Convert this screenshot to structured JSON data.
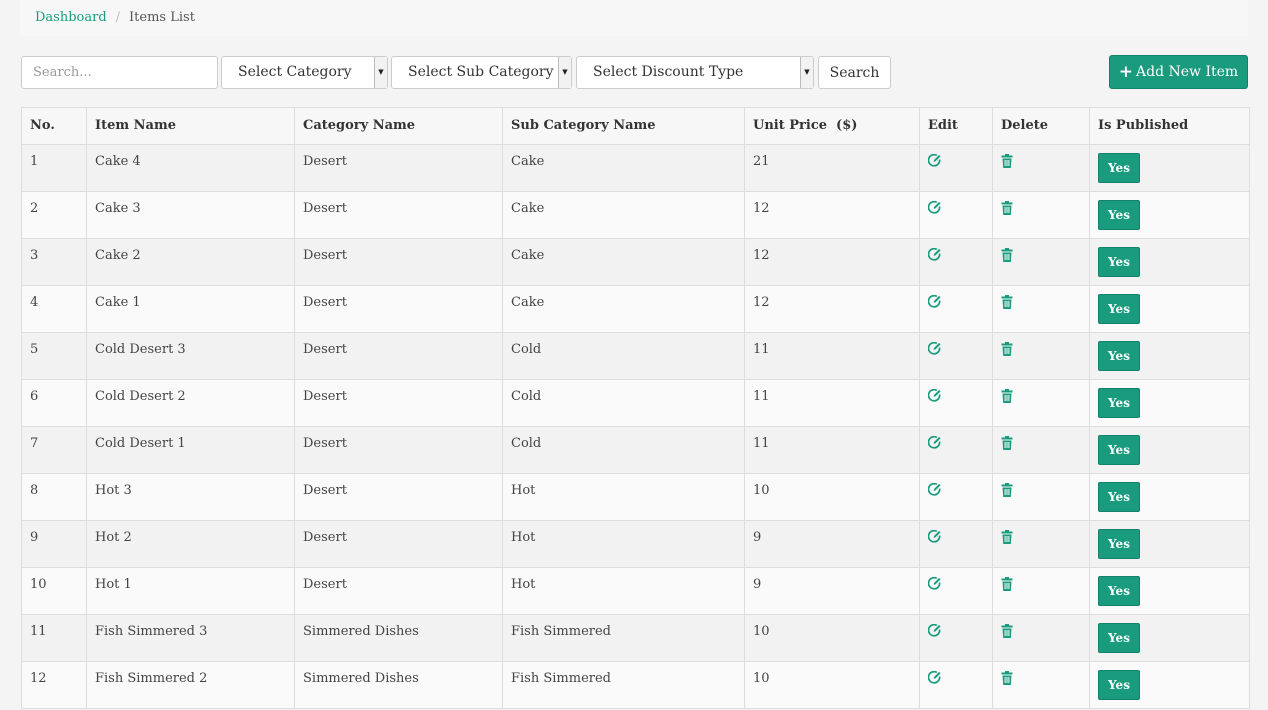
{
  "breadcrumb": {
    "home": "Dashboard",
    "current": "Items List"
  },
  "filters": {
    "search_placeholder": "Search...",
    "category": "Select Category",
    "sub_category": "Select Sub Category",
    "discount_type": "Select Discount Type",
    "search_button": "Search",
    "add_button": "Add New Item"
  },
  "table": {
    "headers": {
      "no": "No.",
      "item_name": "Item Name",
      "category": "Category Name",
      "sub_category": "Sub Category Name",
      "price": "Unit Price  ($)",
      "edit": "Edit",
      "delete": "Delete",
      "published": "Is Published"
    },
    "rows": [
      {
        "no": "1",
        "name": "Cake 4",
        "category": "Desert",
        "sub": "Cake",
        "price": "21",
        "published": "Yes"
      },
      {
        "no": "2",
        "name": "Cake 3",
        "category": "Desert",
        "sub": "Cake",
        "price": "12",
        "published": "Yes"
      },
      {
        "no": "3",
        "name": "Cake 2",
        "category": "Desert",
        "sub": "Cake",
        "price": "12",
        "published": "Yes"
      },
      {
        "no": "4",
        "name": "Cake 1",
        "category": "Desert",
        "sub": "Cake",
        "price": "12",
        "published": "Yes"
      },
      {
        "no": "5",
        "name": "Cold Desert 3",
        "category": "Desert",
        "sub": "Cold",
        "price": "11",
        "published": "Yes"
      },
      {
        "no": "6",
        "name": "Cold Desert 2",
        "category": "Desert",
        "sub": "Cold",
        "price": "11",
        "published": "Yes"
      },
      {
        "no": "7",
        "name": "Cold Desert 1",
        "category": "Desert",
        "sub": "Cold",
        "price": "11",
        "published": "Yes"
      },
      {
        "no": "8",
        "name": "Hot 3",
        "category": "Desert",
        "sub": "Hot",
        "price": "10",
        "published": "Yes"
      },
      {
        "no": "9",
        "name": "Hot 2",
        "category": "Desert",
        "sub": "Hot",
        "price": "9",
        "published": "Yes"
      },
      {
        "no": "10",
        "name": "Hot 1",
        "category": "Desert",
        "sub": "Hot",
        "price": "9",
        "published": "Yes"
      },
      {
        "no": "11",
        "name": "Fish Simmered 3",
        "category": "Simmered Dishes",
        "sub": "Fish Simmered",
        "price": "10",
        "published": "Yes"
      },
      {
        "no": "12",
        "name": "Fish Simmered 2",
        "category": "Simmered Dishes",
        "sub": "Fish Simmered",
        "price": "10",
        "published": "Yes"
      }
    ]
  },
  "colors": {
    "accent": "#1a9b7e",
    "background": "#f4f4f4"
  },
  "icons": {
    "edit": "edit-icon",
    "delete": "trash-icon",
    "add": "plus-icon",
    "dropdown": "caret-down-icon"
  }
}
